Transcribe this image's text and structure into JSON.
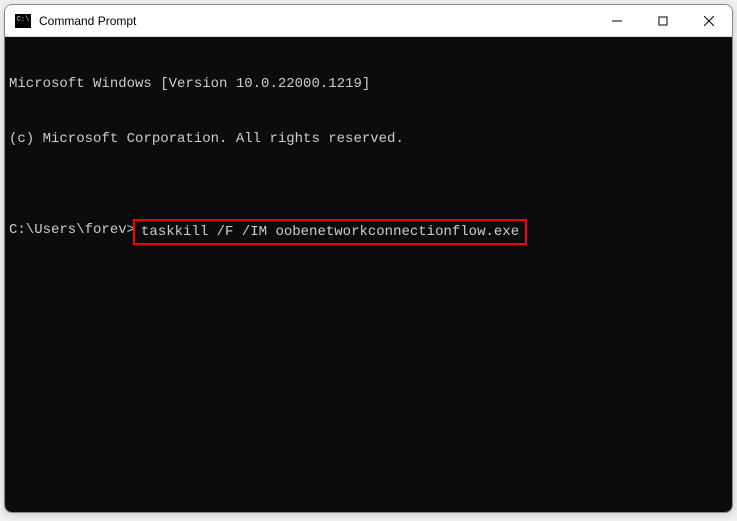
{
  "window": {
    "title": "Command Prompt"
  },
  "terminal": {
    "line1": "Microsoft Windows [Version 10.0.22000.1219]",
    "line2": "(c) Microsoft Corporation. All rights reserved.",
    "blank": "",
    "prompt": "C:\\Users\\forev>",
    "command": "taskkill /F /IM oobenetworkconnectionflow.exe"
  }
}
